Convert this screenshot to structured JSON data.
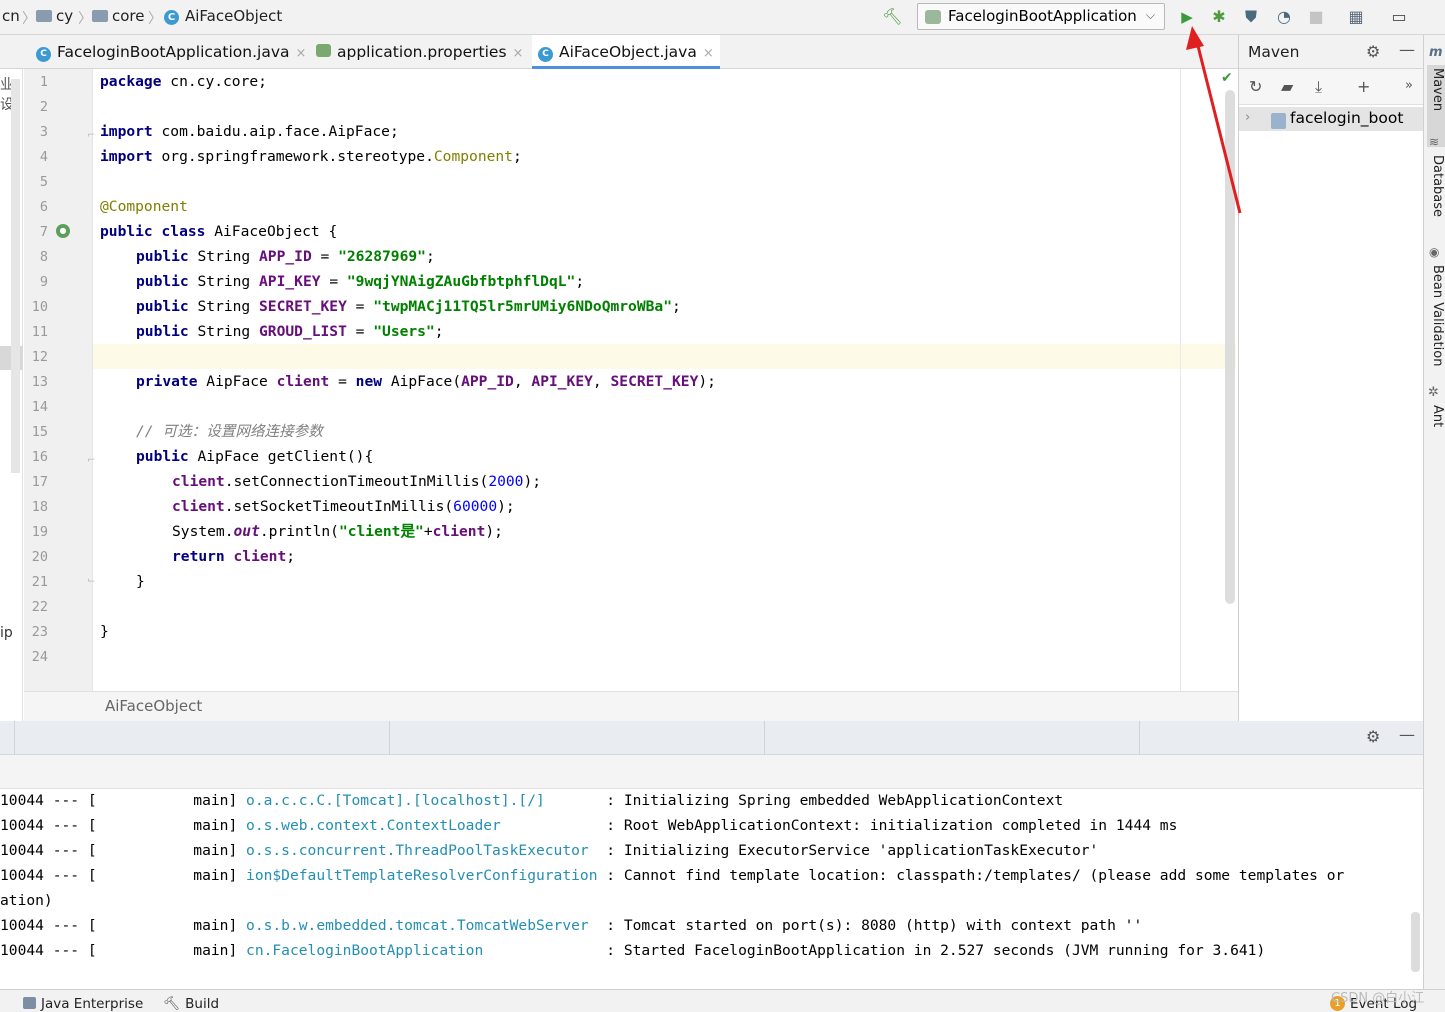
{
  "breadcrumb": [
    "cn",
    "cy",
    "core",
    "AiFaceObject"
  ],
  "run_config": "FaceloginBootApplication",
  "colors": {
    "accent": "#4e8fe0",
    "run_green": "#3b9a3b",
    "annotation_red": "#e02020"
  },
  "toolbar_icons": [
    "hammer-icon",
    "run-icon",
    "debug-icon",
    "coverage-icon",
    "profile-icon",
    "stop-icon",
    "project-structure-icon",
    "terminal-icon"
  ],
  "tabs": [
    {
      "label": "FaceloginBootApplication.java",
      "close": "×"
    },
    {
      "label": "application.properties",
      "close": "×"
    },
    {
      "label": "AiFaceObject.java",
      "close": "×"
    }
  ],
  "left_panel": {
    "fragment_top": "业设",
    "fragment_bottom": "ip"
  },
  "line_numbers": [
    "1",
    "2",
    "3",
    "4",
    "5",
    "6",
    "7",
    "8",
    "9",
    "10",
    "11",
    "12",
    "13",
    "14",
    "15",
    "16",
    "17",
    "18",
    "19",
    "20",
    "21",
    "22",
    "23",
    "24"
  ],
  "code": {
    "l1_kw": "package",
    "l1_rest": " cn.cy.core;",
    "l3_kw": "import",
    "l3_rest": " com.baidu.aip.face.AipFace;",
    "l4_kw": "import",
    "l4_a": " org.springframework.stereotype.",
    "l4_b": "Component",
    "l4_c": ";",
    "l6": "@Component",
    "l7_kw1": "public",
    "l7_kw2": "class",
    "l7_rest": " AiFaceObject {",
    "l8_kw": "public",
    "l8_type": " String ",
    "l8_f": "APP_ID",
    "l8_eq": " = ",
    "l8_s": "\"26287969\"",
    "l8_e": ";",
    "l9_kw": "public",
    "l9_type": " String ",
    "l9_f": "API_KEY",
    "l9_eq": " = ",
    "l9_s": "\"9wqjYNAigZAuGbfbtphflDqL\"",
    "l9_e": ";",
    "l10_kw": "public",
    "l10_type": " String ",
    "l10_f": "SECRET_KEY",
    "l10_eq": " = ",
    "l10_s": "\"twpMACj11TQ5lr5mrUMiy6NDoQmroWBa\"",
    "l10_e": ";",
    "l11_kw": "public",
    "l11_type": " String ",
    "l11_f": "GROUD_LIST",
    "l11_eq": " = ",
    "l11_s": "\"Users\"",
    "l11_e": ";",
    "l13_kw": "private",
    "l13_type": " AipFace ",
    "l13_f": "client",
    "l13_eq": " = ",
    "l13_new": "new",
    "l13_a": " AipFace(",
    "l13_p1": "APP_ID",
    "l13_c1": ", ",
    "l13_p2": "API_KEY",
    "l13_c2": ", ",
    "l13_p3": "SECRET_KEY",
    "l13_e": ");",
    "l15": "// 可选：设置网络连接参数",
    "l16_kw": "public",
    "l16_rest": " AipFace getClient(){",
    "l17_f": "client",
    "l17_a": ".setConnectionTimeoutInMillis(",
    "l17_n": "2000",
    "l17_e": ");",
    "l18_f": "client",
    "l18_a": ".setSocketTimeoutInMillis(",
    "l18_n": "60000",
    "l18_e": ");",
    "l19_a": "System.",
    "l19_out": "out",
    "l19_b": ".println(",
    "l19_s": "\"client是\"",
    "l19_plus": "+",
    "l19_f": "client",
    "l19_e": ");",
    "l20_kw": "return",
    "l20_sp": " ",
    "l20_f": "client",
    "l20_e": ";",
    "l21": "}",
    "l23": "}"
  },
  "editor_breadcrumb": "AiFaceObject",
  "maven": {
    "title": "Maven",
    "project": "facelogin_boot",
    "more": "»"
  },
  "side_tabs": [
    "Maven",
    "Database",
    "Bean Validation",
    "Ant"
  ],
  "log": [
    {
      "pid": "10044",
      "sep": " --- [",
      "thread": "           main] ",
      "logger": "o.a.c.c.C.[Tomcat].[localhost].[/]      ",
      "msg": " : Initializing Spring embedded WebApplicationContext"
    },
    {
      "pid": "10044",
      "sep": " --- [",
      "thread": "           main] ",
      "logger": "o.s.web.context.ContextLoader           ",
      "msg": " : Root WebApplicationContext: initialization completed in 1444 ms"
    },
    {
      "pid": "10044",
      "sep": " --- [",
      "thread": "           main] ",
      "logger": "o.s.s.concurrent.ThreadPoolTaskExecutor ",
      "msg": " : Initializing ExecutorService 'applicationTaskExecutor'"
    },
    {
      "pid": "10044",
      "sep": " --- [",
      "thread": "           main] ",
      "logger": "ion$DefaultTemplateResolverConfiguration",
      "msg": " : Cannot find template location: classpath:/templates/ (please add some templates or"
    },
    {
      "pid": "",
      "sep": "",
      "thread": "",
      "logger": "",
      "msg": "ation)"
    },
    {
      "pid": "10044",
      "sep": " --- [",
      "thread": "           main] ",
      "logger": "o.s.b.w.embedded.tomcat.TomcatWebServer ",
      "msg": " : Tomcat started on port(s): 8080 (http) with context path ''"
    },
    {
      "pid": "10044",
      "sep": " --- [",
      "thread": "           main] ",
      "logger": "cn.FaceloginBootApplication             ",
      "msg": " : Started FaceloginBootApplication in 2.527 seconds (JVM running for 3.641)"
    }
  ],
  "status": {
    "java_enterprise": "Java Enterprise",
    "build": "Build",
    "event_log": "Event Log",
    "event_count": "1",
    "watermark": "CSDN @白小江"
  }
}
